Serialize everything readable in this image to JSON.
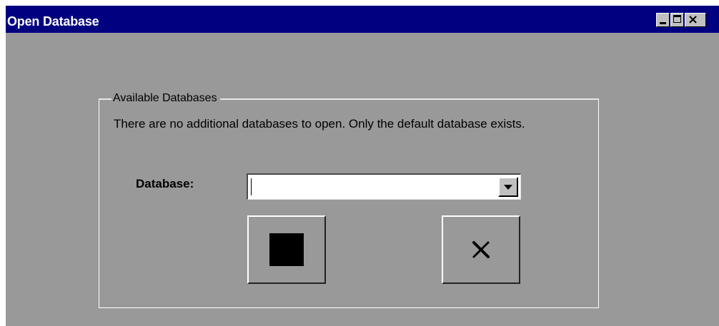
{
  "window": {
    "title": "Open Database",
    "controls": {
      "minimize_icon": "minimize-icon",
      "maximize_icon": "maximize-icon",
      "close_icon": "close-icon",
      "close_glyph": "×"
    }
  },
  "group": {
    "legend": "Available Databases",
    "message": "There are no additional databases to open. Only the default database exists."
  },
  "database_field": {
    "label": "Database:",
    "value": "",
    "dropdown_icon": "chevron-down-icon"
  },
  "buttons": {
    "open": {
      "icon": "stop-square-icon"
    },
    "cancel": {
      "icon": "close-x-icon"
    }
  },
  "colors": {
    "titlebar": "#000080",
    "title_text": "#ffffff",
    "window_background": "#999999",
    "control_face": "#c0c0c0"
  }
}
